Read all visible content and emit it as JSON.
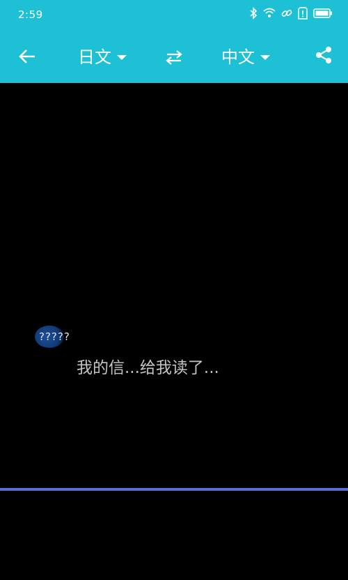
{
  "status": {
    "time": "2:59",
    "icons": [
      "bluetooth-icon",
      "wifi-icon",
      "link-icon",
      "sim-alert-icon",
      "battery-icon"
    ]
  },
  "toolbar": {
    "back_icon": "arrow-left-icon",
    "source_language": "日文",
    "target_language": "中文",
    "swap_icon": "swap-icon",
    "share_icon": "share-icon"
  },
  "content": {
    "bubble_text": "?????",
    "subtitle": "我的信...给我读了..."
  },
  "colors": {
    "topbar": "#1ec0d6",
    "background": "#000000",
    "divider": "#5c6bd6",
    "subtitle": "#c4c4c4"
  }
}
